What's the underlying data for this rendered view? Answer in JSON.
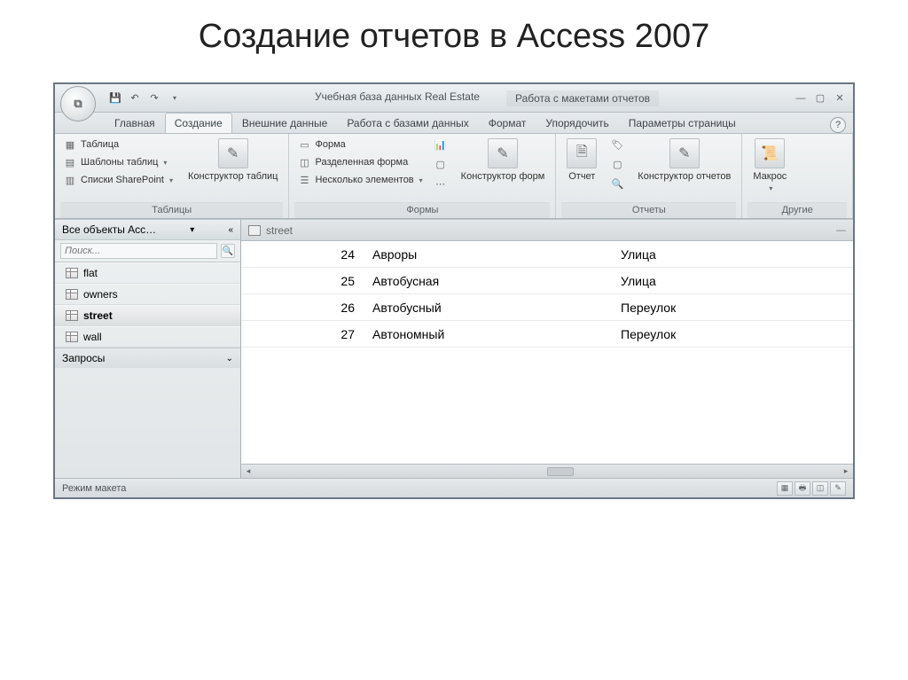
{
  "slide_title": "Создание отчетов в Access 2007",
  "app_title": "Учебная база данных Real Estate",
  "context_title": "Работа с макетами отчетов",
  "tabs": {
    "home": "Главная",
    "create": "Создание",
    "external": "Внешние данные",
    "dbtools": "Работа с базами данных",
    "format": "Формат",
    "arrange": "Упорядочить",
    "pagesetup": "Параметры страницы"
  },
  "ribbon": {
    "tables": {
      "table": "Таблица",
      "templates": "Шаблоны таблиц",
      "sharepoint": "Списки SharePoint",
      "designer": "Конструктор таблиц",
      "group": "Таблицы"
    },
    "forms": {
      "form": "Форма",
      "split": "Разделенная форма",
      "multi": "Несколько элементов",
      "designer": "Конструктор форм",
      "group": "Формы"
    },
    "reports": {
      "report": "Отчет",
      "designer": "Конструктор отчетов",
      "group": "Отчеты"
    },
    "other": {
      "macro": "Макрос",
      "group": "Другие"
    }
  },
  "nav": {
    "header": "Все объекты Acc…",
    "search_placeholder": "Поиск...",
    "items": [
      {
        "label": "flat",
        "selected": false
      },
      {
        "label": "owners",
        "selected": false
      },
      {
        "label": "street",
        "selected": true
      },
      {
        "label": "wall",
        "selected": false
      }
    ],
    "section": "Запросы"
  },
  "doc": {
    "tab_title": "street",
    "rows": [
      {
        "id": "24",
        "name": "Авроры",
        "type": "Улица"
      },
      {
        "id": "25",
        "name": "Автобусная",
        "type": "Улица"
      },
      {
        "id": "26",
        "name": "Автобусный",
        "type": "Переулок"
      },
      {
        "id": "27",
        "name": "Автономный",
        "type": "Переулок"
      }
    ]
  },
  "status": "Режим макета"
}
